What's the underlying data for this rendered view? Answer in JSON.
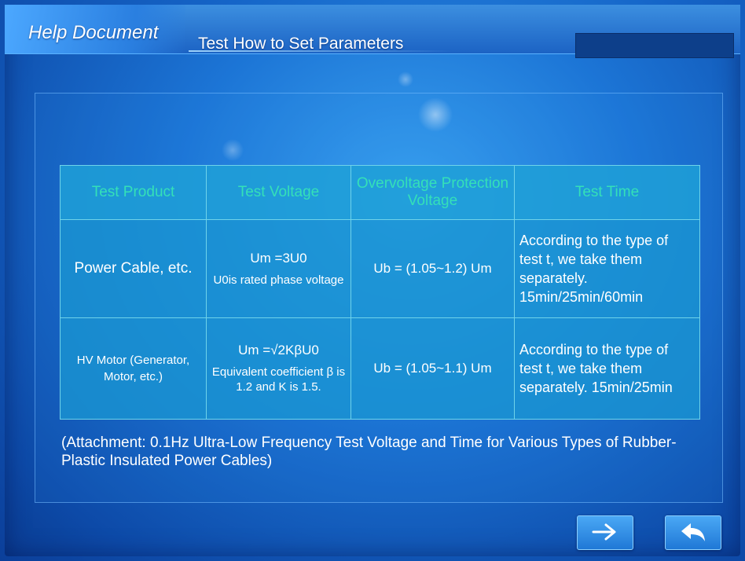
{
  "header": {
    "title": "Help Document",
    "subtitle": "Test How to Set Parameters"
  },
  "table": {
    "headers": [
      "Test Product",
      "Test Voltage",
      "Overvoltage Protection Voltage",
      "Test Time"
    ],
    "rows": [
      {
        "product": "Power Cable, etc.",
        "voltage_formula": "Um =3U0",
        "voltage_note": "U0is rated phase voltage",
        "overvoltage": "Ub = (1.05~1.2) Um",
        "time": "According to the type of test t, we take them separately. 15min/25min/60min"
      },
      {
        "product": "HV Motor (Generator, Motor, etc.)",
        "voltage_formula": "Um =√2KβU0",
        "voltage_note": "Equivalent coefficient β is 1.2 and K is 1.5.",
        "overvoltage": "Ub = (1.05~1.1) Um",
        "time": "According to the type of test t, we take them separately. 15min/25min"
      }
    ]
  },
  "attachment": "(Attachment: 0.1Hz Ultra-Low Frequency Test Voltage and Time for Various Types of Rubber-Plastic Insulated Power Cables)",
  "nav": {
    "next_icon": "arrow-right-icon",
    "back_icon": "return-arrow-icon"
  },
  "colors": {
    "header_text": "#34e0b8",
    "cell_bg": "#1996d2",
    "background": "#1565c8"
  }
}
